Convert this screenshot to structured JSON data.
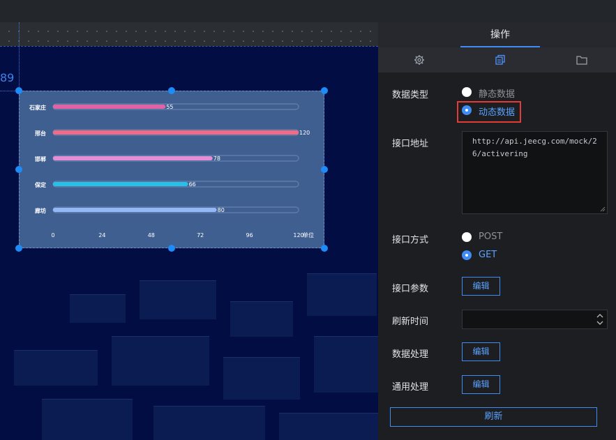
{
  "canvas": {
    "coord_label": "89"
  },
  "chart_data": {
    "type": "bar",
    "orientation": "horizontal",
    "categories": [
      "石家庄",
      "邢台",
      "邯郸",
      "保定",
      "廊坊"
    ],
    "values": [
      55,
      120,
      78,
      66,
      80
    ],
    "bar_colors": [
      "#e063a6",
      "#f36a86",
      "#e58ed5",
      "#27c0e8",
      "#93b8f5"
    ],
    "xticks": [
      0,
      24,
      48,
      72,
      96,
      120
    ],
    "xlim": [
      0,
      120
    ],
    "xunit_label": "单位"
  },
  "panel": {
    "title": "操作",
    "tabs": [
      {
        "icon": "gear-icon"
      },
      {
        "icon": "copy-icon"
      },
      {
        "icon": "folder-icon"
      }
    ],
    "data_type": {
      "label": "数据类型",
      "options": [
        "静态数据",
        "动态数据"
      ],
      "selected": "动态数据"
    },
    "api_url": {
      "label": "接口地址",
      "value": "http://api.jeecg.com/mock/26/activering"
    },
    "api_method": {
      "label": "接口方式",
      "options": [
        "POST",
        "GET"
      ],
      "selected": "GET"
    },
    "api_params": {
      "label": "接口参数",
      "button": "编辑"
    },
    "refresh_time": {
      "label": "刷新时间",
      "value": ""
    },
    "data_process": {
      "label": "数据处理",
      "button": "编辑"
    },
    "common_process": {
      "label": "通用处理",
      "button": "编辑"
    },
    "refresh_button": "刷新"
  }
}
